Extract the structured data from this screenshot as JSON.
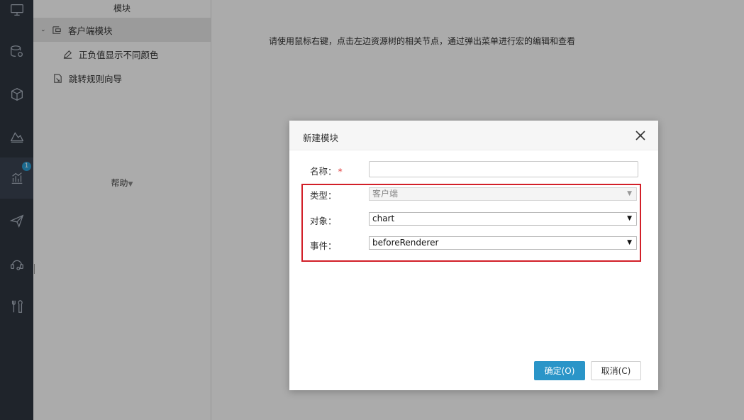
{
  "rail": {
    "badge": "1",
    "items": [
      {
        "icon": "monitor-icon"
      },
      {
        "icon": "database-settings-icon"
      },
      {
        "icon": "cube-icon"
      },
      {
        "icon": "template-icon"
      },
      {
        "icon": "chart-icon"
      },
      {
        "icon": "send-icon"
      },
      {
        "icon": "user-support-icon"
      },
      {
        "icon": "tools-icon"
      }
    ]
  },
  "tree": {
    "header": "模块",
    "items": [
      {
        "label": "客户端模块",
        "icon": "module-icon"
      },
      {
        "label": "正负值显示不同颜色",
        "icon": "edit-icon"
      },
      {
        "label": "跳转规则向导",
        "icon": "wizard-icon"
      }
    ],
    "help": "帮助"
  },
  "main": {
    "hint": "请使用鼠标右键，点击左边资源树的相关节点，通过弹出菜单进行宏的编辑和查看"
  },
  "dialog": {
    "title": "新建模块",
    "name_label": "名称：",
    "required_mark": "*",
    "name_value": "",
    "type_label": "类型：",
    "type_value": "客户端",
    "object_label": "对象：",
    "object_value": "chart",
    "event_label": "事件：",
    "event_value": "beforeRenderer",
    "ok_label": "确定(O)",
    "cancel_label": "取消(C)"
  },
  "colors": {
    "rail_bg": "#2f3640",
    "primary_button": "#2a95c8",
    "highlight_border": "#d21f28",
    "badge": "#2a9fd6"
  }
}
